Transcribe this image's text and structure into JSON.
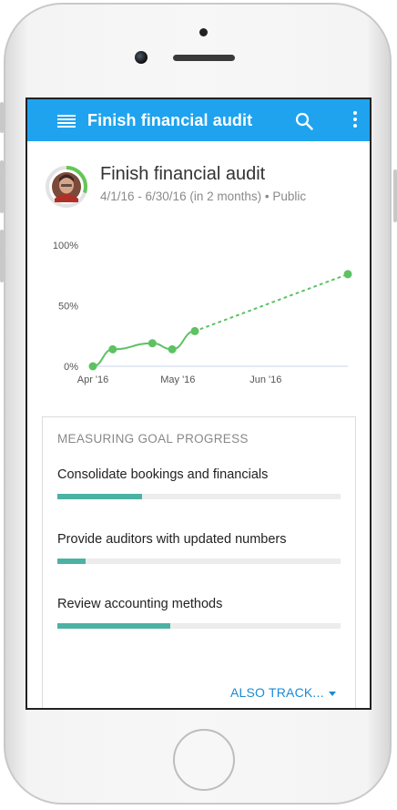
{
  "appbar": {
    "title": "Finish financial audit",
    "color": "#1fa3ef"
  },
  "goal": {
    "title": "Finish financial audit",
    "meta": "4/1/16 - 6/30/16 (in 2 months) • Public",
    "progress_ring_fraction": 0.3
  },
  "chart_data": {
    "type": "line",
    "x_ticks": [
      "Apr '16",
      "May '16",
      "Jun '16"
    ],
    "y_ticks": [
      "100%",
      "50%",
      "0%"
    ],
    "ylim": [
      0,
      100
    ],
    "xlim": [
      "2016-04-01",
      "2016-06-30"
    ],
    "series": [
      {
        "style": "solid",
        "color": "#5cc262",
        "points": [
          {
            "x": "2016-04-01",
            "y": 0
          },
          {
            "x": "2016-04-08",
            "y": 14
          },
          {
            "x": "2016-04-22",
            "y": 19
          },
          {
            "x": "2016-04-29",
            "y": 14
          },
          {
            "x": "2016-05-07",
            "y": 29
          }
        ]
      },
      {
        "style": "dotted",
        "color": "#5cc262",
        "points": [
          {
            "x": "2016-05-07",
            "y": 29
          },
          {
            "x": "2016-06-30",
            "y": 76
          }
        ]
      }
    ]
  },
  "card": {
    "heading": "MEASURING GOAL PROGRESS",
    "key_results": [
      {
        "label": "Consolidate bookings and financials",
        "progress": 0.3
      },
      {
        "label": "Provide auditors with updated numbers",
        "progress": 0.1
      },
      {
        "label": "Review accounting methods",
        "progress": 0.4
      }
    ],
    "also_track": "ALSO TRACK..."
  }
}
